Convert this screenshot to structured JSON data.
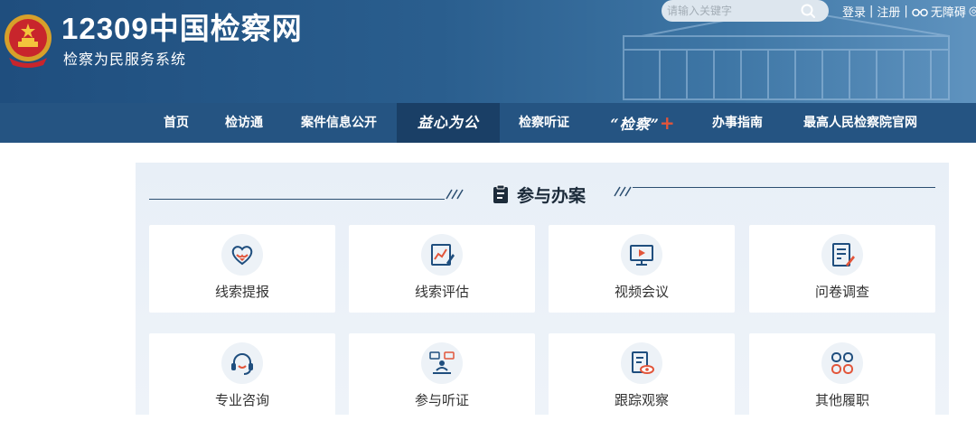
{
  "header": {
    "logo_title": "12309中国检察网",
    "logo_subtitle": "检察为民服务系统",
    "search_placeholder": "请输入关键字",
    "login": "登录",
    "register": "注册",
    "accessibility": "无障碍",
    "separator": "|"
  },
  "nav": {
    "items": [
      {
        "label": "首页"
      },
      {
        "label": "检访通"
      },
      {
        "label": "案件信息公开"
      },
      {
        "label": "益心为公"
      },
      {
        "label": "检察听证"
      },
      {
        "label": "“检察”",
        "suffix": "+"
      },
      {
        "label": "办事指南"
      },
      {
        "label": "最高人民检察院官网"
      }
    ]
  },
  "section": {
    "title": "参与办案",
    "cards": [
      {
        "label": "线索提报",
        "icon": "heart-hand-icon"
      },
      {
        "label": "线索评估",
        "icon": "chart-pen-icon"
      },
      {
        "label": "视频会议",
        "icon": "monitor-play-icon"
      },
      {
        "label": "问卷调查",
        "icon": "document-pen-icon"
      },
      {
        "label": "专业咨询",
        "icon": "headset-icon"
      },
      {
        "label": "参与听证",
        "icon": "hearing-icon"
      },
      {
        "label": "跟踪观察",
        "icon": "document-eye-icon"
      },
      {
        "label": "其他履职",
        "icon": "grid-icon"
      }
    ]
  },
  "colors": {
    "nav_bg": "#255482",
    "nav_active": "#1a3f66",
    "accent_red": "#e2553a",
    "icon_blue": "#1f4e7e"
  }
}
